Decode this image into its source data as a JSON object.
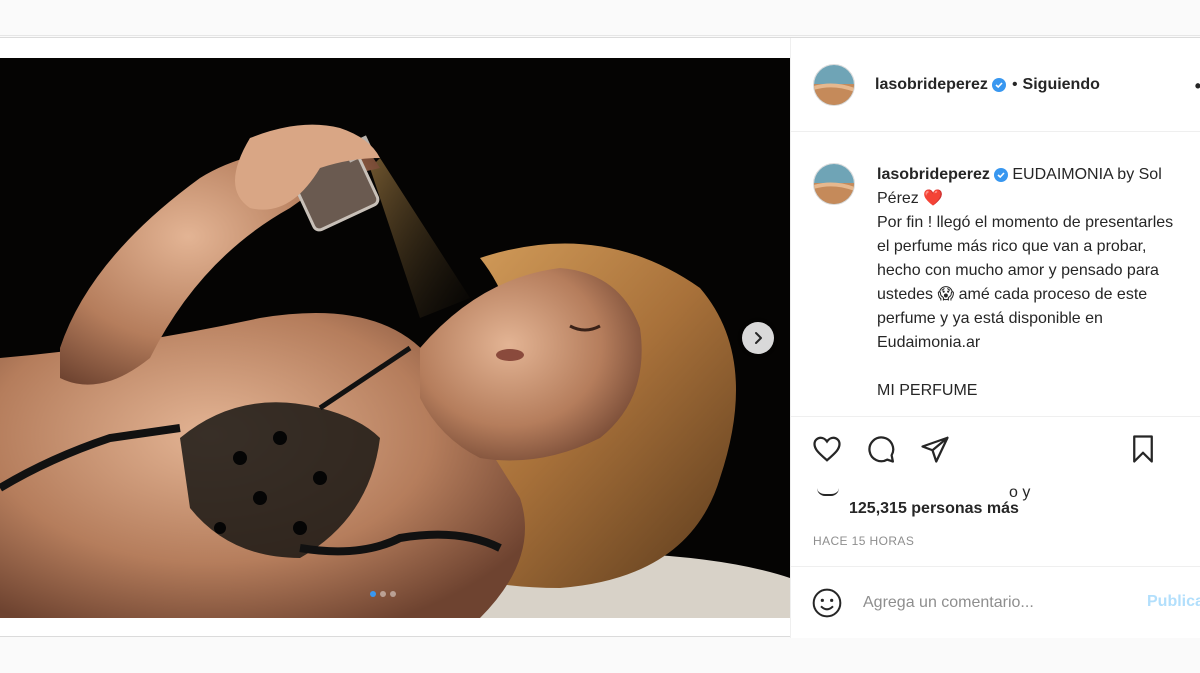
{
  "post": {
    "author": {
      "username": "lasobrideperez",
      "verified": true,
      "follow_separator": "•",
      "follow_status": "Siguiendo",
      "more_glyph": "•"
    },
    "caption": {
      "username": "lasobrideperez",
      "text": " EUDAIMONIA by Sol Pérez ❤️\nPor fin ! llegó el momento de presentarles el perfume más rico que van a probar, hecho con mucho amor y pensado para ustedes 😱 amé cada proceso de este perfume y ya está disponible en Eudaimonia.ar\n\nMI PERFUME"
    },
    "actions": {
      "like_icon": "heart-icon",
      "comment_icon": "comment-bubble-icon",
      "share_icon": "paper-plane-icon",
      "save_icon": "bookmark-icon"
    },
    "likes": {
      "partial_text": "o y",
      "count_text": "125,315 personas más"
    },
    "timestamp": "HACE 15 HORAS",
    "comment": {
      "placeholder": "Agrega un comentario...",
      "publish_label": "Publicar",
      "emoji_icon": "smiley-icon"
    },
    "carousel": {
      "slide_count": 3,
      "active_index": 0,
      "next_icon": "chevron-right-icon"
    },
    "colors": {
      "accent_blue": "#3897f0",
      "publish_disabled": "#b2dffc",
      "heart_red": "#e0245e"
    }
  }
}
